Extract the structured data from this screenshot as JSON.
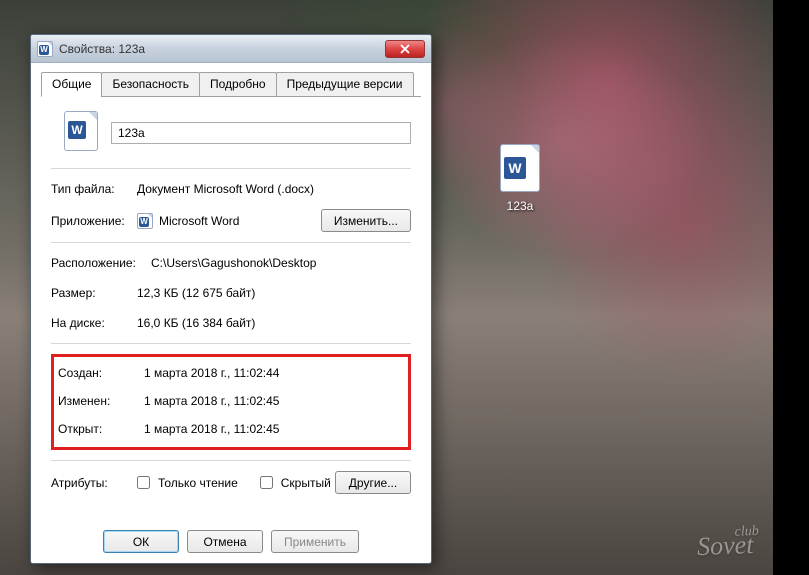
{
  "window": {
    "title_prefix": "Свойства: ",
    "title_file": "123а"
  },
  "tabs": {
    "general": "Общие",
    "security": "Безопасность",
    "details": "Подробно",
    "previous": "Предыдущие версии"
  },
  "filename": "123а",
  "rows": {
    "type_label": "Тип файла:",
    "type_value": "Документ Microsoft Word (.docx)",
    "app_label": "Приложение:",
    "app_value": "Microsoft Word",
    "change_btn": "Изменить...",
    "location_label": "Расположение:",
    "location_value": "C:\\Users\\Gagushonok\\Desktop",
    "size_label": "Размер:",
    "size_value": "12,3 КБ (12 675 байт)",
    "ondisk_label": "На диске:",
    "ondisk_value": "16,0 КБ (16 384 байт)",
    "created_label": "Создан:",
    "created_value": "1 марта 2018 г., 11:02:44",
    "modified_label": "Изменен:",
    "modified_value": "1 марта 2018 г., 11:02:45",
    "accessed_label": "Открыт:",
    "accessed_value": "1 марта 2018 г., 11:02:45",
    "attrs_label": "Атрибуты:",
    "readonly_label": "Только чтение",
    "hidden_label": "Скрытый",
    "other_btn": "Другие..."
  },
  "footer": {
    "ok": "ОК",
    "cancel": "Отмена",
    "apply": "Применить"
  },
  "desktop_icon_label": "123а",
  "watermark": {
    "l1": "club",
    "l2": "Sovet"
  }
}
